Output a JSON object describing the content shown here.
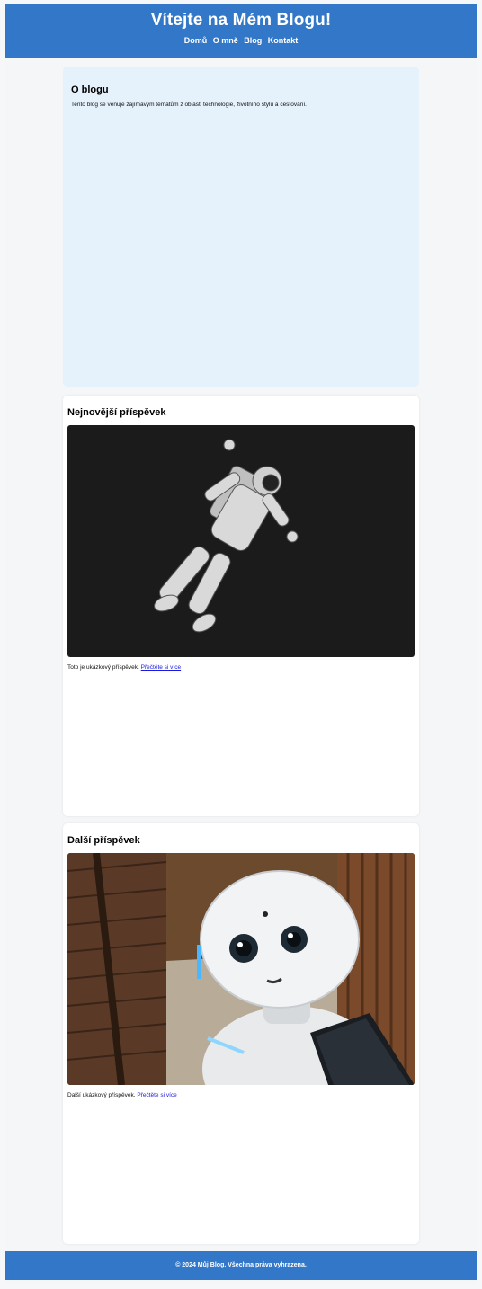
{
  "header": {
    "title": "Vítejte na Mém Blogu!",
    "nav": [
      "Domů",
      "O mně",
      "Blog",
      "Kontakt"
    ]
  },
  "about": {
    "heading": "O blogu",
    "text": "Tento blog se věnuje zajímavým tématům z oblasti technologie, životního stylu a cestování."
  },
  "posts": [
    {
      "heading": "Nejnovější příspěvek",
      "image": "astronaut-photo",
      "text": "Toto je ukázkový příspěvek.",
      "link": "Přečtěte si více"
    },
    {
      "heading": "Další příspěvek",
      "image": "robot-photo",
      "text": "Další ukázkový příspěvek.",
      "link": "Přečtěte si více"
    }
  ],
  "footer": {
    "text": "© 2024 Můj Blog. Všechna práva vyhrazena."
  },
  "colors": {
    "brand": "#3277c8",
    "about_bg": "#e5f1fb",
    "link": "#1a1adb"
  }
}
